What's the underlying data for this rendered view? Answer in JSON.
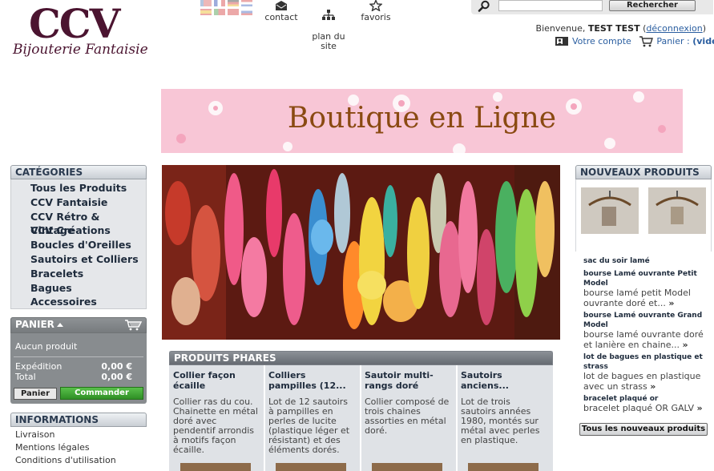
{
  "logo": {
    "mono": "CCV",
    "subtitle": "Bijouterie Fantaisie"
  },
  "header": {
    "links": [
      {
        "label": "contact",
        "icon": "envelope-icon"
      },
      {
        "label": "plan du\nsite",
        "icon": "sitemap-icon"
      },
      {
        "label": "favoris",
        "icon": "star-icon"
      }
    ],
    "search": {
      "value": "",
      "placeholder": "",
      "button_label": "Rechercher"
    },
    "user": {
      "greeting": "Bienvenue,",
      "name": "TEST TEST",
      "logout": "déconnexion",
      "account": "Votre compte",
      "cart_label": "Panier :",
      "cart_value": "(vide)"
    }
  },
  "banner": {
    "text": "Boutique en Ligne",
    "color": "#f8c6d6"
  },
  "categories": {
    "title": "CATÉGORIES",
    "items": [
      "Tous les Produits",
      "CCV Fantaisie",
      "CCV Rétro & Vintage",
      "CCV Créations",
      "Boucles d'Oreilles",
      "Sautoirs et Colliers",
      "Bracelets",
      "Bagues",
      "Accessoires"
    ]
  },
  "cart": {
    "title": "PANIER",
    "empty": "Aucun produit",
    "shipping_label": "Expédition",
    "shipping_value": "0,00 €",
    "total_label": "Total",
    "total_value": "0,00 €",
    "panier_button": "Panier",
    "order_button": "Commander"
  },
  "info": {
    "title": "INFORMATIONS",
    "items": [
      "Livraison",
      "Mentions légales",
      "Conditions d'utilisation"
    ]
  },
  "featured": {
    "title": "PRODUITS PHARES",
    "products": [
      {
        "title": "Collier façon écaille",
        "desc": "Collier ras du cou. Chainette en métal doré avec pendentif arrondis à motifs façon écaille."
      },
      {
        "title": "Colliers pampilles (12...",
        "desc": "Lot de 12 sautoirs à pampilles en perles de lucite (plastique léger et résistant) et des éléments dorés."
      },
      {
        "title": "Sautoir multi-rangs doré",
        "desc": "Collier composé de trois chaines assorties en métal doré."
      },
      {
        "title": "Sautoirs anciens...",
        "desc": "Lot de trois sautoirs années 1980, montés sur métal avec perles en plastique."
      }
    ]
  },
  "new_products": {
    "title": "NOUVEAUX PRODUITS",
    "items": [
      {
        "name": "sac du soir lamé",
        "desc": ""
      },
      {
        "name": "bourse Lamé ouvrante Petit Model",
        "desc": "bourse lamé  petit Model ouvrante doré et..."
      },
      {
        "name": "bourse Lamé ouvrante Grand Model",
        "desc": "bourse lamé ouvrante doré et lanière en chaine..."
      },
      {
        "name": "lot de bagues en plastique et strass",
        "desc": "lot de bagues en plastique avec un strass"
      },
      {
        "name": "bracelet plaqué or",
        "desc": "bracelet plaqué OR GALV"
      }
    ],
    "raquo": "»",
    "all_button": "Tous les nouveaux produits"
  }
}
